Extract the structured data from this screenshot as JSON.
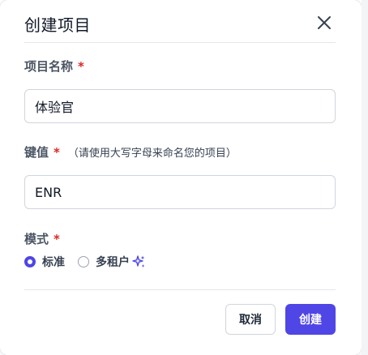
{
  "dialog": {
    "title": "创建项目",
    "close_icon": "close-icon"
  },
  "project_name": {
    "label": "项目名称",
    "required_mark": "*",
    "value": "体验官"
  },
  "key": {
    "label": "键值",
    "required_mark": "*",
    "hint": "（请使用大写字母来命名您的项目）",
    "value": "ENR"
  },
  "mode": {
    "label": "模式",
    "required_mark": "*",
    "options": [
      {
        "label": "标准",
        "checked": true
      },
      {
        "label": "多租户",
        "checked": false,
        "icon": "sparkle-icon"
      }
    ]
  },
  "footer": {
    "cancel_label": "取消",
    "create_label": "创建"
  },
  "colors": {
    "accent": "#4f46e5",
    "required": "#dc2626",
    "border": "#d1d5db"
  }
}
